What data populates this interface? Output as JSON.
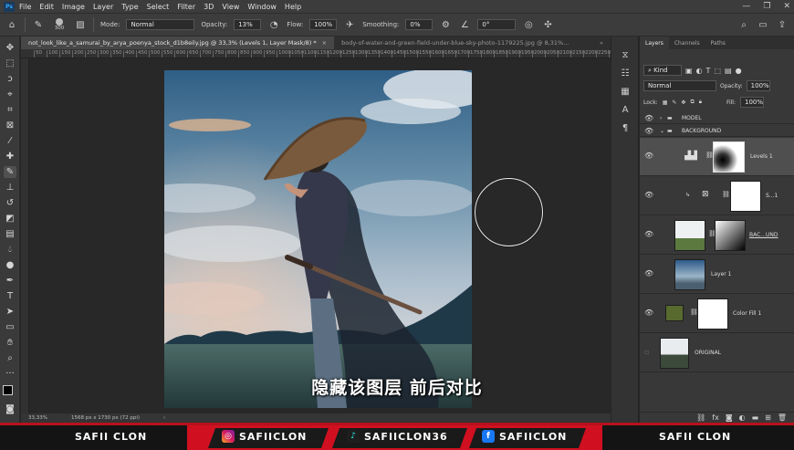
{
  "menu": {
    "items": [
      "File",
      "Edit",
      "Image",
      "Layer",
      "Type",
      "Select",
      "Filter",
      "3D",
      "View",
      "Window",
      "Help"
    ]
  },
  "options": {
    "brush_size": "300",
    "mode_label": "Mode:",
    "mode_value": "Normal",
    "opacity_label": "Opacity:",
    "opacity_value": "13%",
    "flow_label": "Flow:",
    "flow_value": "100%",
    "smoothing_label": "Smoothing:",
    "smoothing_value": "0%",
    "angle_value": "0°"
  },
  "tabs": [
    {
      "label": "not_look_like_a_samurai_by_arya_poenya_stock_d1b8eily.jpg @ 33,3% (Levels 1, Layer Mask/8) *",
      "active": true
    },
    {
      "label": "body-of-water-and-green-field-under-blue-sky-photo-1179225.jpg @ 8,31%...",
      "active": false
    }
  ],
  "ruler_marks": [
    "50",
    "100",
    "150",
    "200",
    "250",
    "300",
    "350",
    "400",
    "450",
    "500",
    "550",
    "600",
    "650",
    "700",
    "750",
    "800",
    "850",
    "900",
    "950",
    "1000",
    "1050",
    "1100",
    "1150",
    "1200",
    "1250",
    "1300",
    "1350",
    "1400",
    "1450",
    "1500",
    "1550",
    "1600",
    "1650",
    "1700",
    "1750",
    "1800",
    "1850",
    "1900",
    "1950",
    "2000",
    "2050",
    "2100",
    "2150",
    "2200",
    "2250",
    "2300"
  ],
  "status": {
    "zoom": "33,33%",
    "doc_size": "1568 px x 1730 px (72 ppi)"
  },
  "subtitle": "隐藏该图层 前后对比",
  "layers_panel": {
    "tabs": [
      "Layers",
      "Channels",
      "Paths"
    ],
    "kind_label": "Kind",
    "blend_mode": "Normal",
    "opacity_label": "Opacity:",
    "opacity_value": "100%",
    "lock_label": "Lock:",
    "fill_label": "Fill:",
    "fill_value": "100%",
    "layers": [
      {
        "name": "MODEL",
        "type": "group"
      },
      {
        "name": "BACKGROUND",
        "type": "group"
      },
      {
        "name": "Levels 1",
        "type": "adjustment"
      },
      {
        "name": "S...1",
        "type": "clipped"
      },
      {
        "name": "BAC...UND",
        "type": "image"
      },
      {
        "name": "Layer 1",
        "type": "image"
      },
      {
        "name": "Color Fill 1",
        "type": "fill"
      },
      {
        "name": "ORIGINAL",
        "type": "image"
      }
    ]
  },
  "banner": {
    "left_name": "SAFII CLON",
    "instagram": "SAFIICLON",
    "tiktok": "SAFIICLON36",
    "facebook": "SAFIICLON",
    "right_name": "SAFII CLON"
  },
  "colors": {
    "accent_red": "#d01020",
    "ps_blue": "#31a8ff",
    "panel_bg": "#383838"
  }
}
